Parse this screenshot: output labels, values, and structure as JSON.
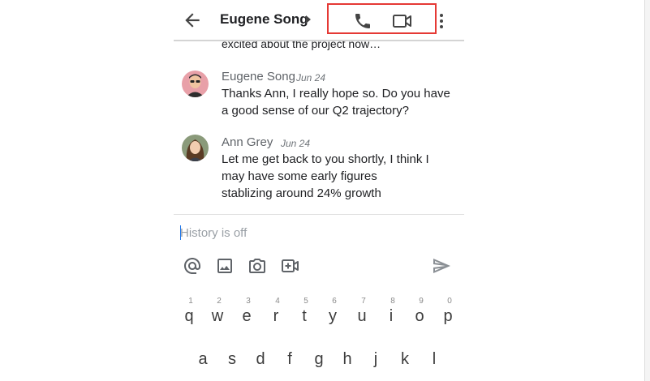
{
  "header": {
    "contact_name": "Eugene Song",
    "icons": {
      "back": "arrow-back-icon",
      "details": "caret-right-icon",
      "call": "phone-icon",
      "video": "video-camera-icon",
      "more": "more-vert-icon"
    },
    "highlight_color": "#e53935"
  },
  "conversation": {
    "previous_snippet": "excited about the project now…",
    "messages": [
      {
        "sender": "Eugene Song",
        "date": "Jun 24",
        "lines": [
          "Thanks Ann, I really hope so. Do you have",
          "a good sense of our Q2 trajectory?"
        ]
      },
      {
        "sender": "Ann Grey",
        "date": "Jun 24",
        "lines": [
          "Let me get back to you shortly, I think I",
          "may have some early figures",
          "stablizing around 24% growth"
        ]
      }
    ]
  },
  "compose": {
    "placeholder": "History is off",
    "value": "",
    "tools": [
      "at-mention-icon",
      "image-icon",
      "camera-icon",
      "add-video-icon"
    ],
    "send_icon": "send-icon"
  },
  "keyboard": {
    "row1": {
      "keys": [
        "q",
        "w",
        "e",
        "r",
        "t",
        "y",
        "u",
        "i",
        "o",
        "p"
      ],
      "hints": [
        "1",
        "2",
        "3",
        "4",
        "5",
        "6",
        "7",
        "8",
        "9",
        "0"
      ]
    },
    "row2": {
      "keys": [
        "a",
        "s",
        "d",
        "f",
        "g",
        "h",
        "j",
        "k",
        "l"
      ]
    }
  },
  "colors": {
    "accent": "#1a73e8",
    "icon": "#5f6368",
    "text": "#202124"
  }
}
